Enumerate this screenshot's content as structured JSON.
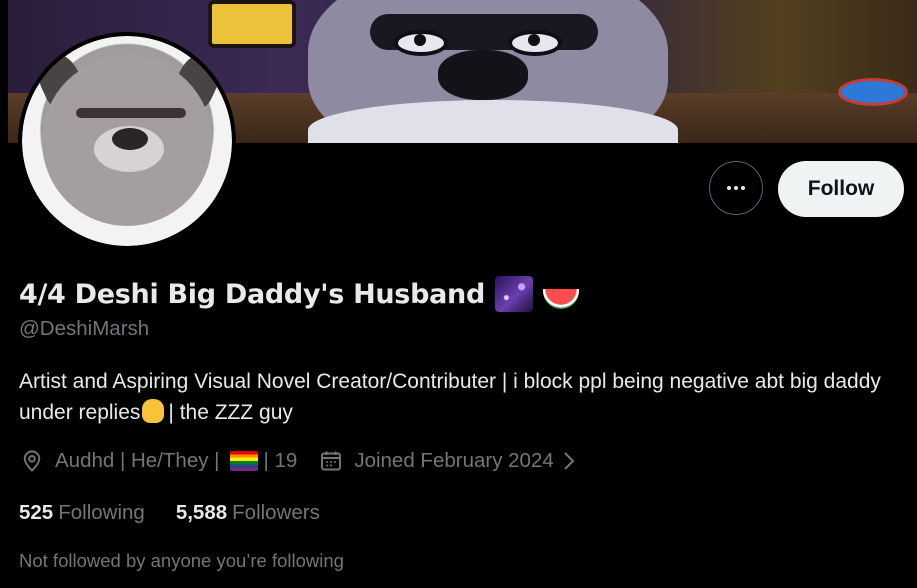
{
  "profile": {
    "display_name": "4/4 Deshi Big Daddy's Husband",
    "name_emojis": [
      "milky-way-emoji",
      "watermelon-emoji"
    ],
    "handle": "@DeshiMarsh",
    "bio_part1": "Artist and Aspiring Visual Novel Creator/Contributer | i block ppl being negative abt big daddy under replies",
    "bio_emoji": "raised-hand-emoji",
    "bio_part2": "| the ZZZ guy",
    "location_part1": "Audhd | He/They |",
    "location_flag": "rainbow-flag-emoji",
    "location_part2": "| 19",
    "joined": "Joined February 2024",
    "following_count": "525",
    "following_label": "Following",
    "followers_count": "5,588",
    "followers_label": "Followers",
    "not_followed_text": "Not followed by anyone you’re following"
  },
  "actions": {
    "follow_label": "Follow",
    "more_icon": "more-dots-icon"
  },
  "colors": {
    "background": "#000000",
    "primary_text": "#e7e9ea",
    "secondary_text": "#71767b",
    "follow_button_bg": "#eff3f4",
    "border": "#536471"
  }
}
